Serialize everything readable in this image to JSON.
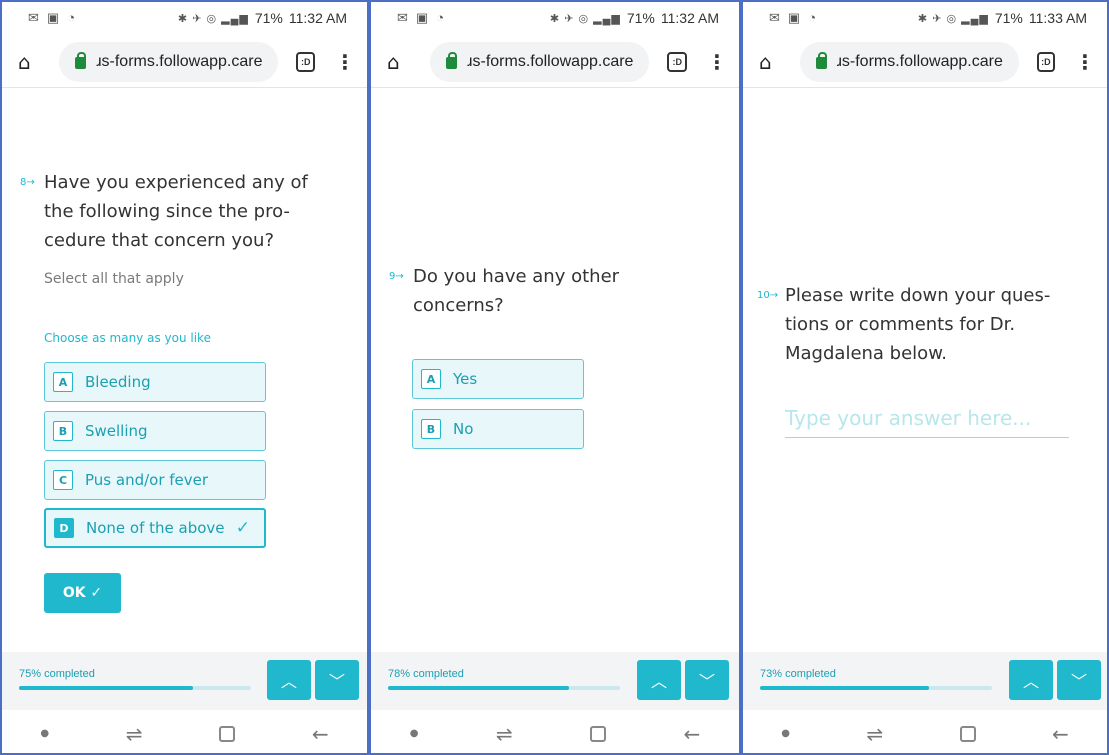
{
  "screens": [
    {
      "status": {
        "time": "11:32 AM",
        "battery": "71%"
      },
      "url": "ɹs-forms.followapp.care",
      "question": {
        "number": "8→",
        "text": "Have you experienced any of the following since the pro-cedure that concern you?",
        "hint": "Select all that apply",
        "choose": "Choose as many as you like"
      },
      "choices": [
        {
          "key": "A",
          "label": "Bleeding",
          "selected": false
        },
        {
          "key": "B",
          "label": "Swelling",
          "selected": false
        },
        {
          "key": "C",
          "label": "Pus and/or fever",
          "selected": false
        },
        {
          "key": "D",
          "label": "None of the above",
          "selected": true
        }
      ],
      "ok_label": "OK ✓",
      "progress": {
        "label": "75% completed",
        "fraction": 0.75
      }
    },
    {
      "status": {
        "time": "11:32 AM",
        "battery": "71%"
      },
      "url": "ɹs-forms.followapp.care",
      "question": {
        "number": "9→",
        "text": "Do you have any other concerns?"
      },
      "choices": [
        {
          "key": "A",
          "label": "Yes",
          "selected": false
        },
        {
          "key": "B",
          "label": "No",
          "selected": false
        }
      ],
      "progress": {
        "label": "78% completed",
        "fraction": 0.78
      }
    },
    {
      "status": {
        "time": "11:33 AM",
        "battery": "71%"
      },
      "url": "ɹs-forms.followapp.care",
      "question": {
        "number": "10→",
        "text": "Please write down your ques-tions or comments for Dr. Magdalena below."
      },
      "answer": {
        "placeholder": "Type your answer here...",
        "value": ""
      },
      "progress": {
        "label": "73% completed",
        "fraction": 0.73
      }
    }
  ],
  "icons": {
    "home": "home-icon",
    "lock": "lock-icon",
    "tabs": "tabs-icon",
    "menu": "menu-icon",
    "up": "chevron-up-icon",
    "down": "chevron-down-icon",
    "check": "checkmark-icon"
  },
  "colors": {
    "accent": "#1fb8cc",
    "choice_bg": "#e8f8fa",
    "frame": "#4a6fc4",
    "lock": "#1e8a3c"
  }
}
